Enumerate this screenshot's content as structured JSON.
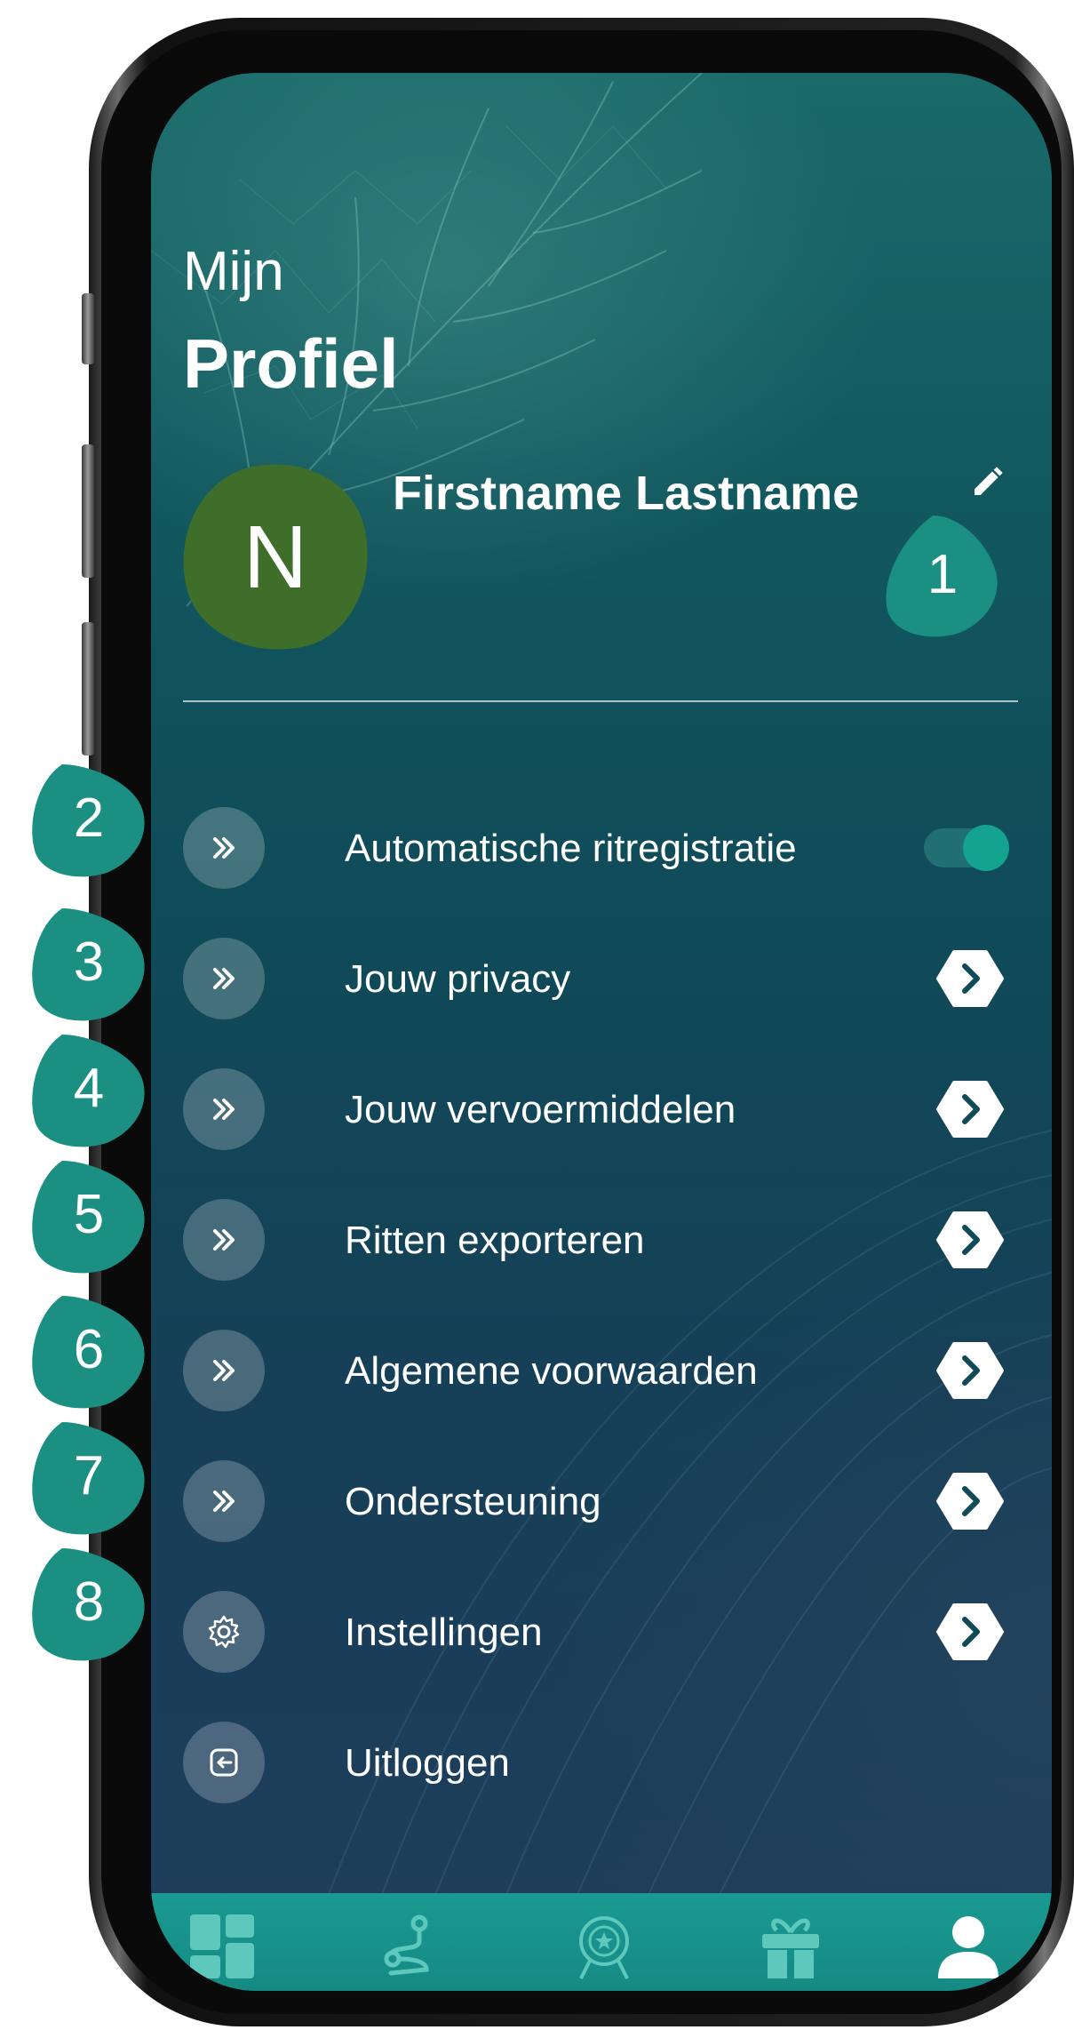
{
  "header": {
    "title_light": "Mijn",
    "title_bold": "Profiel"
  },
  "profile": {
    "initial": "N",
    "name": "Firstname Lastname",
    "edit_icon": "pencil-icon",
    "avatar_color": "#3f6e2a"
  },
  "menu": {
    "items": [
      {
        "label": "Automatische ritregistratie",
        "icon": "double-chevron-right-icon",
        "control": "toggle",
        "toggle_on": true
      },
      {
        "label": "Jouw privacy",
        "icon": "double-chevron-right-icon",
        "control": "chevron"
      },
      {
        "label": "Jouw vervoermiddelen",
        "icon": "double-chevron-right-icon",
        "control": "chevron"
      },
      {
        "label": "Ritten exporteren",
        "icon": "double-chevron-right-icon",
        "control": "chevron"
      },
      {
        "label": "Algemene voorwaarden",
        "icon": "double-chevron-right-icon",
        "control": "chevron"
      },
      {
        "label": "Ondersteuning",
        "icon": "double-chevron-right-icon",
        "control": "chevron"
      },
      {
        "label": "Instellingen",
        "icon": "gear-icon",
        "control": "chevron"
      },
      {
        "label": "Uitloggen",
        "icon": "logout-icon",
        "control": "none"
      }
    ]
  },
  "bottom_nav": {
    "items": [
      {
        "icon": "dashboard-icon",
        "active": false
      },
      {
        "icon": "route-icon",
        "active": false
      },
      {
        "icon": "badge-icon",
        "active": false
      },
      {
        "icon": "gift-icon",
        "active": false
      },
      {
        "icon": "profile-icon",
        "active": true
      }
    ]
  },
  "callouts": [
    "1",
    "2",
    "3",
    "4",
    "5",
    "6",
    "7",
    "8"
  ],
  "colors": {
    "accent": "#13a38e",
    "callout": "#1a8f82",
    "nav_bar": "#1a9a92"
  }
}
